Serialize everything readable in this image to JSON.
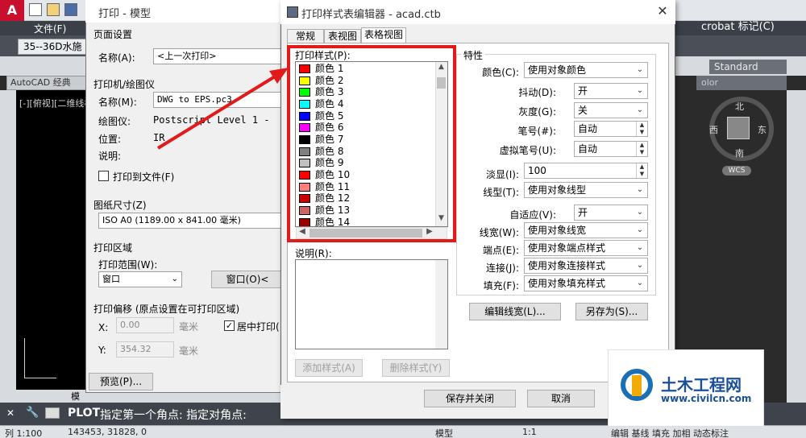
{
  "acad": {
    "menu_file": "文件(F)",
    "doc_tab": "35--36D水施",
    "workspace": "AutoCAD 经典",
    "view_label": "[-][俯视][二维线框",
    "model_tab": "模",
    "command_prefix": "PLOT",
    "command_text": "指定第一个角点: 指定对角点:",
    "status_scale": "列 1:100",
    "status_coords": "143453, 31828, 0",
    "status_model": "模型",
    "status_annot": "1:1",
    "status_right": "编辑 基线 填充 加相 动态标注",
    "acrobat_title": "crobat 标记(C)",
    "standard_box": "Standard",
    "color_box": "olor",
    "compass": {
      "n": "北",
      "s": "南",
      "w": "西",
      "e": "东",
      "wcs": "WCS"
    }
  },
  "plot": {
    "title": "打印 - 模型",
    "page_setup": "页面设置",
    "name_label": "名称(A):",
    "name_value": "<上一次打印>",
    "printer_group": "打印机/绘图仪",
    "printer_name_label": "名称(M):",
    "printer_name_value": "DWG to EPS.pc3",
    "plotter_label": "绘图仪:",
    "plotter_value": "Postscript Level 1 -",
    "where_label": "位置:",
    "where_value": "IR",
    "desc_label": "说明:",
    "print_to_file": "打印到文件(F)",
    "paper_size_group": "图纸尺寸(Z)",
    "paper_size_value": "ISO A0 (1189.00 x 841.00 毫米)",
    "plot_area_group": "打印区域",
    "plot_range_label": "打印范围(W):",
    "plot_range_value": "窗口",
    "window_button": "窗口(O)<",
    "offset_group": "打印偏移 (原点设置在可打印区域)",
    "x_label": "X:",
    "x_value": "0.00",
    "x_unit": "毫米",
    "y_label": "Y:",
    "y_value": "354.32",
    "y_unit": "毫米",
    "center_plot": "居中打印(",
    "preview_button": "预览(P)..."
  },
  "editor": {
    "title": "打印样式表编辑器 - acad.ctb",
    "tabs": [
      "常规",
      "表视图",
      "表格视图"
    ],
    "styles_label": "打印样式(P):",
    "styles": [
      {
        "name": "颜色 1",
        "color": "#ff0000"
      },
      {
        "name": "颜色 2",
        "color": "#ffff00"
      },
      {
        "name": "颜色 3",
        "color": "#00ff00"
      },
      {
        "name": "颜色 4",
        "color": "#00ffff"
      },
      {
        "name": "颜色 5",
        "color": "#0000ff"
      },
      {
        "name": "颜色 6",
        "color": "#ff00ff"
      },
      {
        "name": "颜色 7",
        "color": "#000000"
      },
      {
        "name": "颜色 8",
        "color": "#808080"
      },
      {
        "name": "颜色 9",
        "color": "#c0c0c0"
      },
      {
        "name": "颜色 10",
        "color": "#ff0000"
      },
      {
        "name": "颜色 11",
        "color": "#ff7f7f"
      },
      {
        "name": "颜色 12",
        "color": "#cc0000"
      },
      {
        "name": "颜色 13",
        "color": "#cc6666"
      },
      {
        "name": "颜色 14",
        "color": "#990000"
      }
    ],
    "desc_label": "说明(R):",
    "add_style": "添加样式(A)",
    "delete_style": "删除样式(Y)",
    "props_title": "特性",
    "props": {
      "color_label": "颜色(C):",
      "color_value": "使用对象颜色",
      "dither_label": "抖动(D):",
      "dither_value": "开",
      "grayscale_label": "灰度(G):",
      "grayscale_value": "关",
      "pen_label": "笔号(#):",
      "pen_value": "自动",
      "vpen_label": "虚拟笔号(U):",
      "vpen_value": "自动",
      "screening_label": "淡显(I):",
      "screening_value": "100",
      "linetype_label": "线型(T):",
      "linetype_value": "使用对象线型",
      "adaptive_label": "自适应(V):",
      "adaptive_value": "开",
      "lineweight_label": "线宽(W):",
      "lineweight_value": "使用对象线宽",
      "endpoint_label": "端点(E):",
      "endpoint_value": "使用对象端点样式",
      "join_label": "连接(J):",
      "join_value": "使用对象连接样式",
      "fill_label": "填充(F):",
      "fill_value": "使用对象填充样式"
    },
    "edit_lineweights": "编辑线宽(L)...",
    "save_as": "另存为(S)...",
    "save_close": "保存并关闭",
    "cancel": "取消"
  },
  "watermark": {
    "title": "土木工程网",
    "url": "www.civilcn.com"
  },
  "colors": {
    "highlight": "#e21a1a",
    "arrow": "#e21a1a"
  }
}
